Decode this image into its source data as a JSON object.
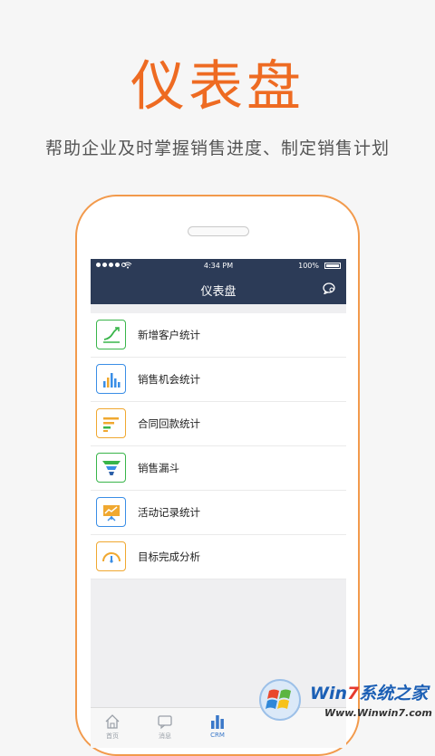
{
  "hero": {
    "title": "仪表盘",
    "subtitle": "帮助企业及时掌握销售进度、制定销售计划"
  },
  "status_bar": {
    "time": "4:34 PM",
    "battery": "100%"
  },
  "navbar": {
    "title": "仪表盘",
    "right_icon": "chat-bubble-icon"
  },
  "menu": {
    "items": [
      {
        "label": "新增客户统计",
        "icon": "growth-line-chart-icon",
        "color": "#39b54a"
      },
      {
        "label": "销售机会统计",
        "icon": "bar-chart-icon",
        "color": "#3a8ee6"
      },
      {
        "label": "合同回款统计",
        "icon": "horizontal-bar-chart-icon",
        "color": "#f0a830"
      },
      {
        "label": "销售漏斗",
        "icon": "funnel-icon",
        "color": "#39b54a"
      },
      {
        "label": "活动记录统计",
        "icon": "presentation-board-icon",
        "color": "#3a8ee6"
      },
      {
        "label": "目标完成分析",
        "icon": "gauge-icon",
        "color": "#f0a830"
      }
    ]
  },
  "tabbar": {
    "tabs": [
      {
        "label": "首页",
        "icon": "home-icon"
      },
      {
        "label": "消息",
        "icon": "message-icon"
      },
      {
        "label": "CRM",
        "icon": "crm-bar-icon",
        "active": true
      }
    ]
  },
  "watermark": {
    "brand_win": "Win",
    "brand_seven": "7",
    "brand_rest": "系统之家",
    "url": "Www.Winwin7.com"
  },
  "colors": {
    "accent": "#ee6b22",
    "navbar": "#2c3b57",
    "tab_active": "#3a78c9"
  }
}
